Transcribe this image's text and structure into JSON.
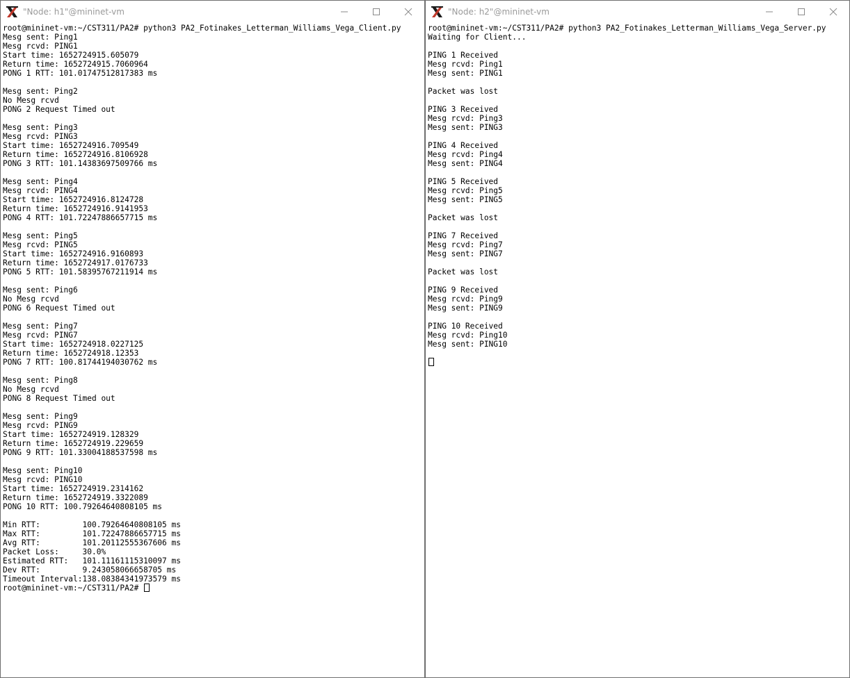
{
  "windows": [
    {
      "title": "\"Node: h1\"@mininet-vm",
      "lines": [
        "root@mininet-vm:~/CST311/PA2# python3 PA2_Fotinakes_Letterman_Williams_Vega_Client.py",
        "Mesg sent: Ping1",
        "Mesg rcvd: PING1",
        "Start time: 1652724915.605079",
        "Return time: 1652724915.7060964",
        "PONG 1 RTT: 101.01747512817383 ms",
        "",
        "Mesg sent: Ping2",
        "No Mesg rcvd",
        "PONG 2 Request Timed out",
        "",
        "Mesg sent: Ping3",
        "Mesg rcvd: PING3",
        "Start time: 1652724916.709549",
        "Return time: 1652724916.8106928",
        "PONG 3 RTT: 101.14383697509766 ms",
        "",
        "Mesg sent: Ping4",
        "Mesg rcvd: PING4",
        "Start time: 1652724916.8124728",
        "Return time: 1652724916.9141953",
        "PONG 4 RTT: 101.72247886657715 ms",
        "",
        "Mesg sent: Ping5",
        "Mesg rcvd: PING5",
        "Start time: 1652724916.9160893",
        "Return time: 1652724917.0176733",
        "PONG 5 RTT: 101.58395767211914 ms",
        "",
        "Mesg sent: Ping6",
        "No Mesg rcvd",
        "PONG 6 Request Timed out",
        "",
        "Mesg sent: Ping7",
        "Mesg rcvd: PING7",
        "Start time: 1652724918.0227125",
        "Return time: 1652724918.12353",
        "PONG 7 RTT: 100.81744194030762 ms",
        "",
        "Mesg sent: Ping8",
        "No Mesg rcvd",
        "PONG 8 Request Timed out",
        "",
        "Mesg sent: Ping9",
        "Mesg rcvd: PING9",
        "Start time: 1652724919.128329",
        "Return time: 1652724919.229659",
        "PONG 9 RTT: 101.33004188537598 ms",
        "",
        "Mesg sent: Ping10",
        "Mesg rcvd: PING10",
        "Start time: 1652724919.2314162",
        "Return time: 1652724919.3322089",
        "PONG 10 RTT: 100.79264640808105 ms",
        "",
        "Min RTT:         100.79264640808105 ms",
        "Max RTT:         101.72247886657715 ms",
        "Avg RTT:         101.20112555367606 ms",
        "Packet Loss:     30.0%",
        "Estimated RTT:   101.11161115310097 ms",
        "Dev RTT:         9.243058066658705 ms",
        "Timeout Interval:138.08384341973579 ms"
      ],
      "prompt": "root@mininet-vm:~/CST311/PA2# "
    },
    {
      "title": "\"Node: h2\"@mininet-vm",
      "lines": [
        "root@mininet-vm:~/CST311/PA2# python3 PA2_Fotinakes_Letterman_Williams_Vega_Server.py",
        "Waiting for Client...",
        "",
        "PING 1 Received",
        "Mesg rcvd: Ping1",
        "Mesg sent: PING1",
        "",
        "Packet was lost",
        "",
        "PING 3 Received",
        "Mesg rcvd: Ping3",
        "Mesg sent: PING3",
        "",
        "PING 4 Received",
        "Mesg rcvd: Ping4",
        "Mesg sent: PING4",
        "",
        "PING 5 Received",
        "Mesg rcvd: Ping5",
        "Mesg sent: PING5",
        "",
        "Packet was lost",
        "",
        "PING 7 Received",
        "Mesg rcvd: Ping7",
        "Mesg sent: PING7",
        "",
        "Packet was lost",
        "",
        "PING 9 Received",
        "Mesg rcvd: Ping9",
        "Mesg sent: PING9",
        "",
        "PING 10 Received",
        "Mesg rcvd: Ping10",
        "Mesg sent: PING10",
        ""
      ],
      "prompt": ""
    }
  ]
}
